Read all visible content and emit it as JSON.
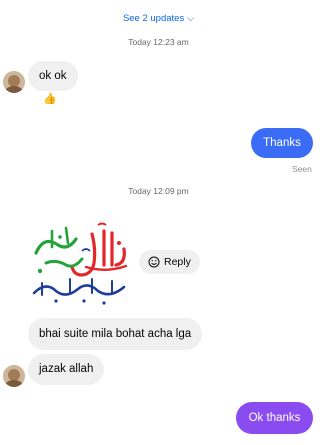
{
  "header": {
    "see_updates": "See 2 updates"
  },
  "timestamps": [
    "Today 12:23 am",
    "Today 12:09 pm"
  ],
  "messages": {
    "m1": "ok ok",
    "m1_reaction": "👍",
    "m2": "Thanks",
    "seen": "Seen",
    "sticker_alt": "السلام عليكم ورحمة الله وبركاته",
    "reply": "Reply",
    "m3": "bhai suite mila bohat acha lga",
    "m4": "jazak allah",
    "m5": "Ok thanks"
  },
  "colors": {
    "outgoing_blue": "#3b6cf6",
    "outgoing_purple": "#8a4cf0",
    "link": "#0a66e8"
  }
}
